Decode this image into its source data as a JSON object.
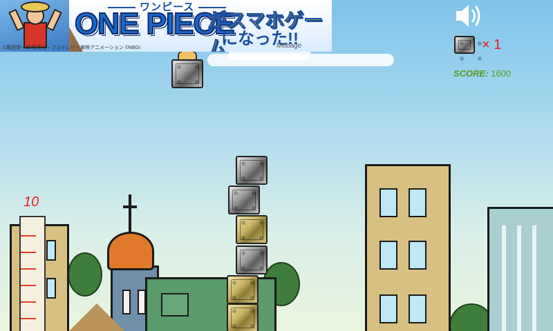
{
  "ad": {
    "tagline": "ワンピース",
    "title": "ONE PIECE",
    "sub_line1": "がスマホゲーム",
    "sub_line2": "になった!!",
    "copyright": "©尾田栄一郎/集英社・フジテレビ・東映アニメーション ©NBGI",
    "brand": "Mobage"
  },
  "hud": {
    "sound_icon": "speaker-on-icon",
    "lives_count": "× 1",
    "score_label": "SCORE:",
    "score_value": "1600"
  },
  "ruler": {
    "label": "10"
  },
  "colors": {
    "sky_top": "#7fc3ea",
    "lives_text": "#e02020",
    "score_text": "#5a9a1e",
    "ruler_marks": "#e23b2a"
  },
  "stack": {
    "held_block": "iron",
    "blocks_bottom_to_top": [
      "gold",
      "gold",
      "iron",
      "gold",
      "iron",
      "iron"
    ]
  }
}
